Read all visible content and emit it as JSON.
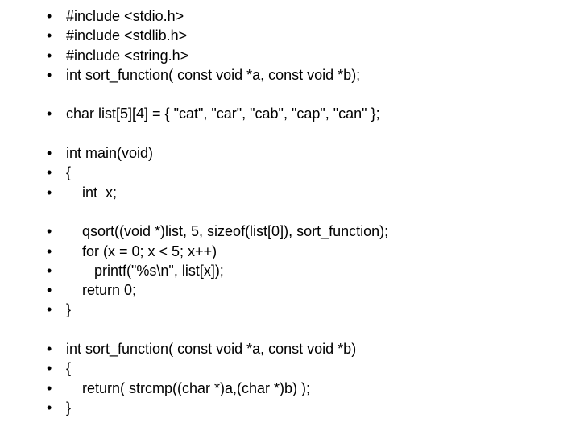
{
  "code": {
    "lines": [
      "#include <stdio.h>",
      "#include <stdlib.h>",
      "#include <string.h>",
      "int sort_function( const void *a, const void *b);",
      "",
      "char list[5][4] = { \"cat\", \"car\", \"cab\", \"cap\", \"can\" };",
      "",
      "int main(void)",
      "{",
      "    int  x;",
      "",
      "    qsort((void *)list, 5, sizeof(list[0]), sort_function);",
      "    for (x = 0; x < 5; x++)",
      "       printf(\"%s\\n\", list[x]);",
      "    return 0;",
      "}",
      "",
      "int sort_function( const void *a, const void *b)",
      "{",
      "    return( strcmp((char *)a,(char *)b) );",
      "}"
    ]
  }
}
